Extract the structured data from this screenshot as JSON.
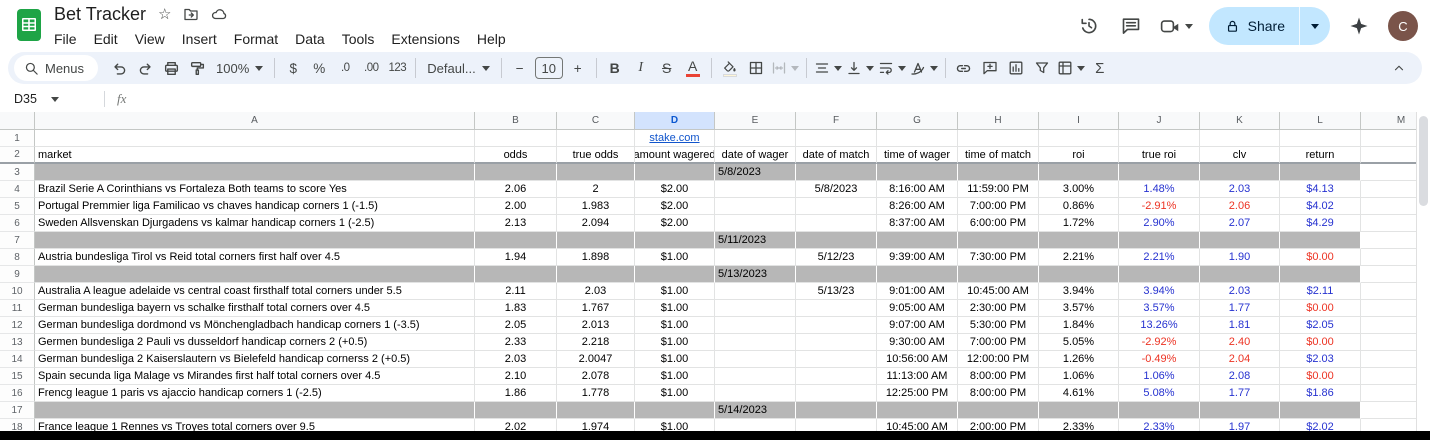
{
  "titlebar": {
    "title": "Bet Tracker",
    "menus": [
      "File",
      "Edit",
      "View",
      "Insert",
      "Format",
      "Data",
      "Tools",
      "Extensions",
      "Help"
    ],
    "share_label": "Share",
    "avatar_letter": "C"
  },
  "toolbar": {
    "menus_label": "Menus",
    "zoom_value": "100%",
    "currency": "$",
    "percent": "%",
    "decrease_decimals": ".0",
    "increase_decimals": ".00",
    "more_formats": "123",
    "font_family": "Defaul...",
    "minus": "−",
    "font_size": "10",
    "plus": "+",
    "bold": "B",
    "italic": "I",
    "strikethrough": "S",
    "text_color": "A",
    "functions": "Σ"
  },
  "formula_bar": {
    "cell_ref": "D35",
    "fx_label": "fx"
  },
  "colors": {
    "positive": "#2632d0",
    "negative": "#ec3323",
    "link": "#1155cc",
    "gray_band": "#b7b7b7",
    "selected_header_bg": "#d3e3fd",
    "selected_header_text": "#0b57d0",
    "text_color_bar": "#ea4335",
    "fill_color_bar": "#fdf5d8"
  },
  "grid": {
    "columns": [
      "A",
      "B",
      "C",
      "D",
      "E",
      "F",
      "G",
      "H",
      "I",
      "J",
      "K",
      "L",
      "M"
    ],
    "selected_column": "D",
    "link_text": "stake.com",
    "header_row": [
      "market",
      "odds",
      "true odds",
      "amount wagered",
      "date of wager",
      "date of match",
      "time of wager",
      "time of match",
      "roi",
      "true roi",
      "clv",
      "return"
    ],
    "rows": [
      {
        "n": 1,
        "type": "link"
      },
      {
        "n": 2,
        "type": "labels"
      },
      {
        "n": 3,
        "type": "group",
        "date": "5/8/2023"
      },
      {
        "n": 4,
        "type": "data",
        "cells": [
          "Brazil Serie A Corinthians vs Fortaleza Both teams to score Yes",
          "2.06",
          "2",
          "$2.00",
          "",
          "5/8/2023",
          "8:16:00 AM",
          "11:59:00 PM",
          "3.00%",
          "1.48%",
          "2.03",
          "$4.13"
        ],
        "jkl": [
          "pos",
          "pos",
          "pos"
        ]
      },
      {
        "n": 5,
        "type": "data",
        "cells": [
          "Portugal Premmier liga Familicao vs chaves handicap corners 1 (-1.5)",
          "2.00",
          "1.983",
          "$2.00",
          "",
          "",
          "8:26:00 AM",
          "7:00:00 PM",
          "0.86%",
          "-2.91%",
          "2.06",
          "$4.02"
        ],
        "jkl": [
          "neg",
          "neg",
          "pos"
        ]
      },
      {
        "n": 6,
        "type": "data",
        "cells": [
          "Sweden Allsvenskan Djurgadens vs kalmar handicap corners 1 (-2.5)",
          "2.13",
          "2.094",
          "$2.00",
          "",
          "",
          "8:37:00 AM",
          "6:00:00 PM",
          "1.72%",
          "2.90%",
          "2.07",
          "$4.29"
        ],
        "jkl": [
          "pos",
          "pos",
          "pos"
        ]
      },
      {
        "n": 7,
        "type": "group",
        "date": "5/11/2023"
      },
      {
        "n": 8,
        "type": "data",
        "cells": [
          "Austria bundesliga Tirol vs Reid total corners first half over 4.5",
          "1.94",
          "1.898",
          "$1.00",
          "",
          "5/12/23",
          "9:39:00 AM",
          "7:30:00 PM",
          "2.21%",
          "2.21%",
          "1.90",
          "$0.00"
        ],
        "jkl": [
          "pos",
          "pos",
          "neg"
        ]
      },
      {
        "n": 9,
        "type": "group",
        "date": "5/13/2023"
      },
      {
        "n": 10,
        "type": "data",
        "cells": [
          "Australia A league adelaide vs central coast firsthalf total corners under 5.5",
          "2.11",
          "2.03",
          "$1.00",
          "",
          "5/13/23",
          "9:01:00 AM",
          "10:45:00 AM",
          "3.94%",
          "3.94%",
          "2.03",
          "$2.11"
        ],
        "jkl": [
          "pos",
          "pos",
          "pos"
        ]
      },
      {
        "n": 11,
        "type": "data",
        "cells": [
          "German bundesliga bayern vs schalke firsthalf total corners over 4.5",
          "1.83",
          "1.767",
          "$1.00",
          "",
          "",
          "9:05:00 AM",
          "2:30:00 PM",
          "3.57%",
          "3.57%",
          "1.77",
          "$0.00"
        ],
        "jkl": [
          "pos",
          "pos",
          "neg"
        ]
      },
      {
        "n": 12,
        "type": "data",
        "cells": [
          "German bundesliga dordmond vs Mönchengladbach handicap corners 1 (-3.5)",
          "2.05",
          "2.013",
          "$1.00",
          "",
          "",
          "9:07:00 AM",
          "5:30:00 PM",
          "1.84%",
          "13.26%",
          "1.81",
          "$2.05"
        ],
        "jkl": [
          "pos",
          "pos",
          "pos"
        ]
      },
      {
        "n": 13,
        "type": "data",
        "cells": [
          "Germen bundesliga 2 Pauli vs dusseldorf handicap corners 2 (+0.5)",
          "2.33",
          "2.218",
          "$1.00",
          "",
          "",
          "9:30:00 AM",
          "7:00:00 PM",
          "5.05%",
          "-2.92%",
          "2.40",
          "$0.00"
        ],
        "jkl": [
          "neg",
          "neg",
          "neg"
        ]
      },
      {
        "n": 14,
        "type": "data",
        "cells": [
          "German bundesliga 2 Kaiserslautern vs Bielefeld handicap cornerss 2 (+0.5)",
          "2.03",
          "2.0047",
          "$1.00",
          "",
          "",
          "10:56:00 AM",
          "12:00:00 PM",
          "1.26%",
          "-0.49%",
          "2.04",
          "$2.03"
        ],
        "jkl": [
          "neg",
          "neg",
          "pos"
        ]
      },
      {
        "n": 15,
        "type": "data",
        "cells": [
          "Spain secunda liga Malage vs Mirandes first half total corners over 4.5",
          "2.10",
          "2.078",
          "$1.00",
          "",
          "",
          "11:13:00 AM",
          "8:00:00 PM",
          "1.06%",
          "1.06%",
          "2.08",
          "$0.00"
        ],
        "jkl": [
          "pos",
          "pos",
          "neg"
        ]
      },
      {
        "n": 16,
        "type": "data",
        "cells": [
          "Frencg league 1 paris vs ajaccio handicap corners 1 (-2.5)",
          "1.86",
          "1.778",
          "$1.00",
          "",
          "",
          "12:25:00 PM",
          "8:00:00 PM",
          "4.61%",
          "5.08%",
          "1.77",
          "$1.86"
        ],
        "jkl": [
          "pos",
          "pos",
          "pos"
        ]
      },
      {
        "n": 17,
        "type": "group",
        "date": "5/14/2023"
      },
      {
        "n": 18,
        "type": "data",
        "cells": [
          "France league 1 Rennes vs Troyes total corners over 9.5",
          "2.02",
          "1.974",
          "$1.00",
          "",
          "",
          "10:45:00 AM",
          "2:00:00 PM",
          "2.33%",
          "2.33%",
          "1.97",
          "$2.02"
        ],
        "jkl": [
          "pos",
          "pos",
          "pos"
        ]
      }
    ]
  }
}
